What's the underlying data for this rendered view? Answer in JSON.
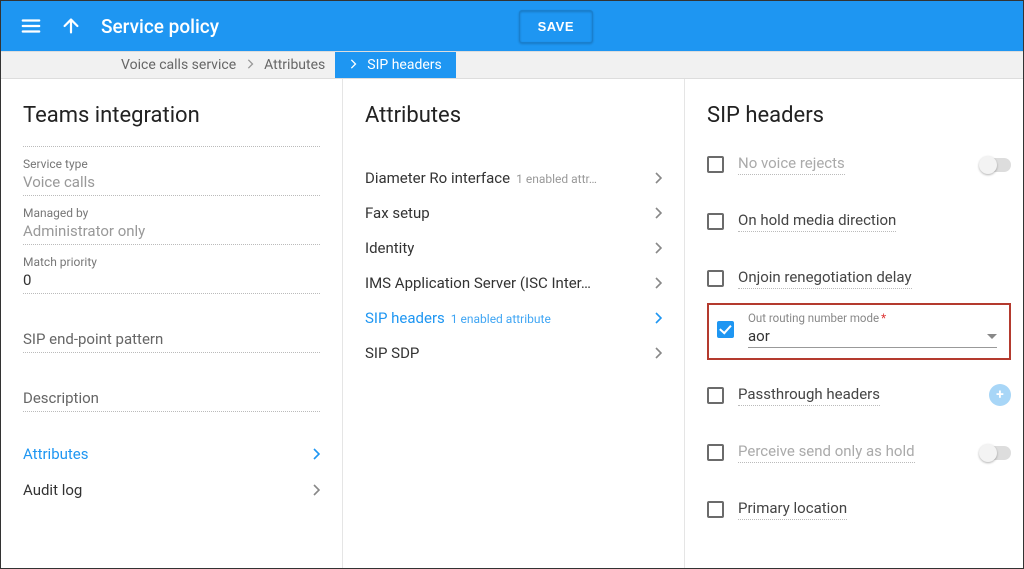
{
  "appbar": {
    "title": "Service policy",
    "save": "SAVE"
  },
  "breadcrumb": {
    "a": "Voice calls service",
    "b": "Attributes",
    "c": "SIP headers"
  },
  "left": {
    "heading": "Teams integration",
    "service_type_label": "Service type",
    "service_type_value": "Voice calls",
    "managed_by_label": "Managed by",
    "managed_by_value": "Administrator only",
    "match_priority_label": "Match priority",
    "match_priority_value": "0",
    "endpoint_label": "SIP end-point pattern",
    "description_label": "Description",
    "nav": {
      "attributes": "Attributes",
      "audit": "Audit log"
    }
  },
  "mid": {
    "heading": "Attributes",
    "items": [
      {
        "label": "Diameter Ro interface",
        "sub": "1 enabled attr…"
      },
      {
        "label": "Fax setup",
        "sub": ""
      },
      {
        "label": "Identity",
        "sub": ""
      },
      {
        "label": "IMS Application Server (ISC Inter…",
        "sub": ""
      },
      {
        "label": "SIP headers",
        "sub": "1 enabled attribute"
      },
      {
        "label": "SIP SDP",
        "sub": ""
      }
    ]
  },
  "right": {
    "heading": "SIP headers",
    "opts": {
      "no_voice": "No voice rejects",
      "on_hold": "On hold media direction",
      "onjoin": "Onjoin renegotiation delay",
      "out_mode_label": "Out routing number mode",
      "out_mode_value": "aor",
      "passthrough": "Passthrough headers",
      "perceive": "Perceive send only as hold",
      "primary": "Primary location"
    }
  }
}
